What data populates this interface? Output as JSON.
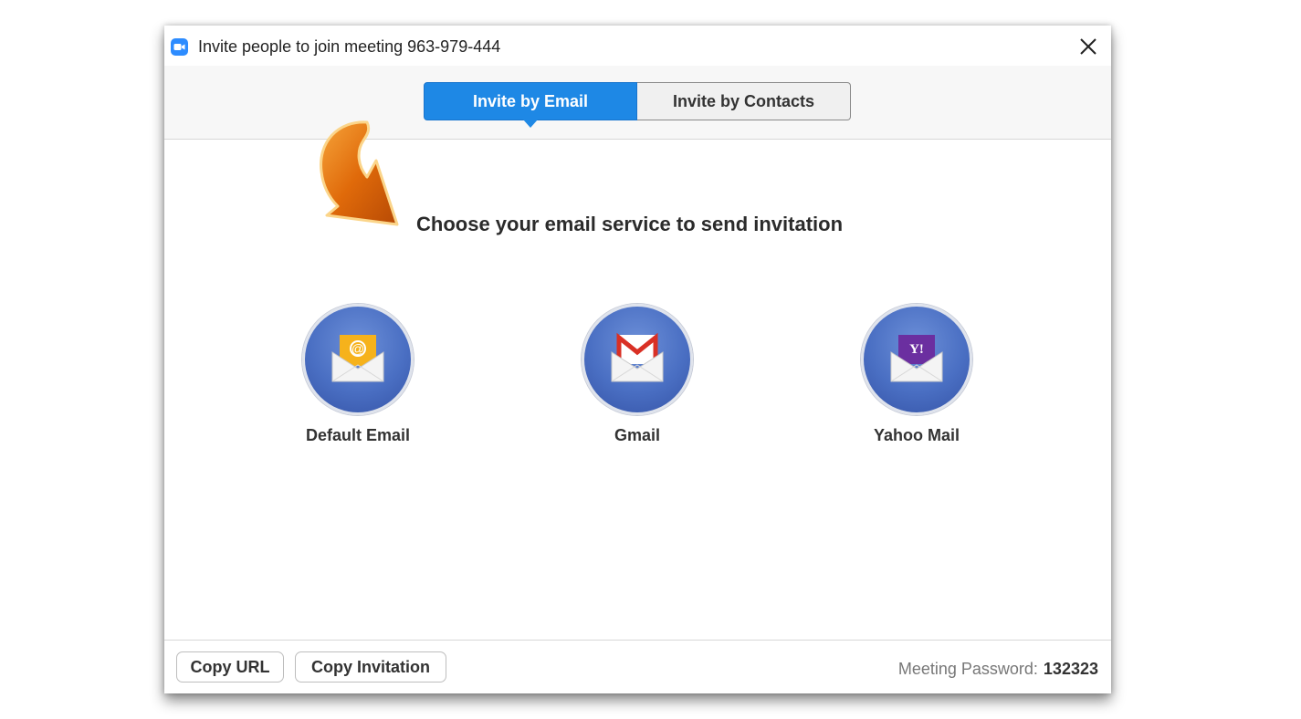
{
  "window": {
    "title": "Invite people to join meeting 963-979-444",
    "icon": "zoom-camera-icon",
    "close_icon": "close-icon"
  },
  "tabs": [
    {
      "label": "Invite by Email",
      "active": true
    },
    {
      "label": "Invite by Contacts",
      "active": false
    }
  ],
  "main": {
    "heading": "Choose your email service to send invitation",
    "services": [
      {
        "label": "Default Email",
        "icon": "default-email-icon"
      },
      {
        "label": "Gmail",
        "icon": "gmail-icon"
      },
      {
        "label": "Yahoo Mail",
        "icon": "yahoo-mail-icon"
      }
    ]
  },
  "footer": {
    "copy_url": "Copy URL",
    "copy_invitation": "Copy Invitation",
    "password_label": "Meeting Password:",
    "password_value": "132323"
  },
  "colors": {
    "accent": "#1e88e5",
    "service_circle": "#4a6fc3",
    "arrow": "#e8750c"
  }
}
